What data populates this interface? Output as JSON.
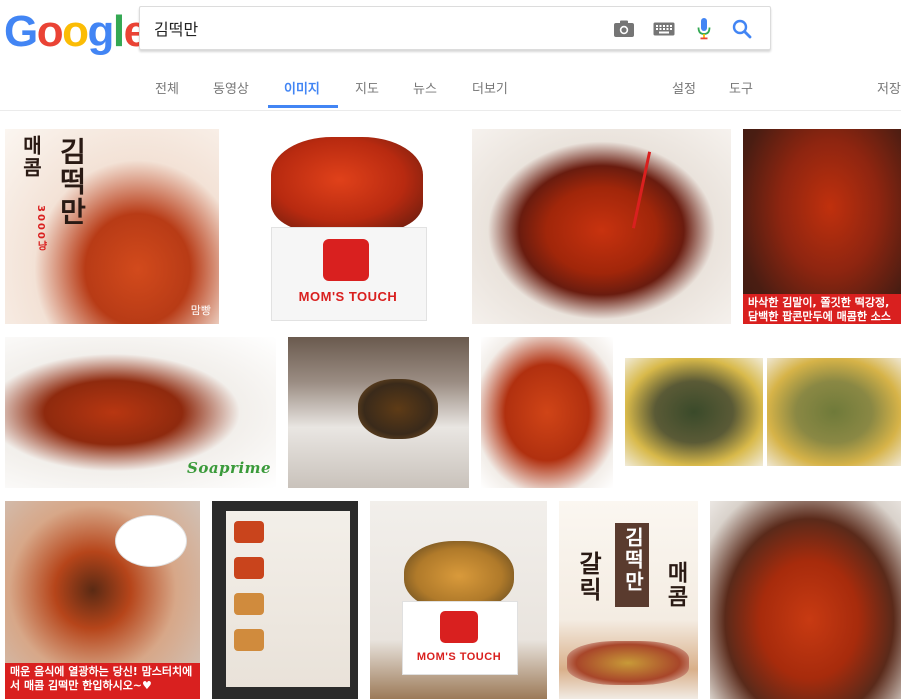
{
  "logo": {
    "letters": [
      "G",
      "o",
      "o",
      "g",
      "l",
      "e"
    ],
    "colors": [
      "#4285f4",
      "#ea4335",
      "#fbbc05",
      "#4285f4",
      "#34a853",
      "#ea4335"
    ]
  },
  "search": {
    "query": "김떡만"
  },
  "icons": {
    "camera": "camera-icon",
    "keyboard": "keyboard-icon",
    "mic": "mic-icon",
    "search": "search-icon"
  },
  "tabs": {
    "all": "전체",
    "videos": "동영상",
    "images": "이미지",
    "maps": "지도",
    "news": "뉴스",
    "more": "더보기",
    "settings": "설정",
    "tools": "도구",
    "saved": "저장"
  },
  "accent": "#4285f4",
  "images": {
    "i1": {
      "line1": "매콤",
      "line2": "김떡만",
      "price": "3000냥",
      "caption": "맘빵"
    },
    "i2": {
      "brand": "MOM'S TOUCH"
    },
    "i3": {},
    "i4": {
      "caption": "바삭한 김말이, 쫄깃한 떡강정, 담백한 팝콘만두에 매콤한 소스까"
    },
    "i5": {
      "brand": "Soaprime"
    },
    "i6": {},
    "i7": {},
    "i8": {},
    "i9": {},
    "i10": {
      "caption": "매운 음식에 열광하는 당신! 맘스터치에서 매콤 김떡만 한입하시오~♥"
    },
    "i11": {},
    "i12": {
      "brand": "MOM'S TOUCH"
    },
    "i13": {
      "line1": "갈릭",
      "line2": "김떡만",
      "line3": "매콤"
    },
    "i14": {}
  }
}
